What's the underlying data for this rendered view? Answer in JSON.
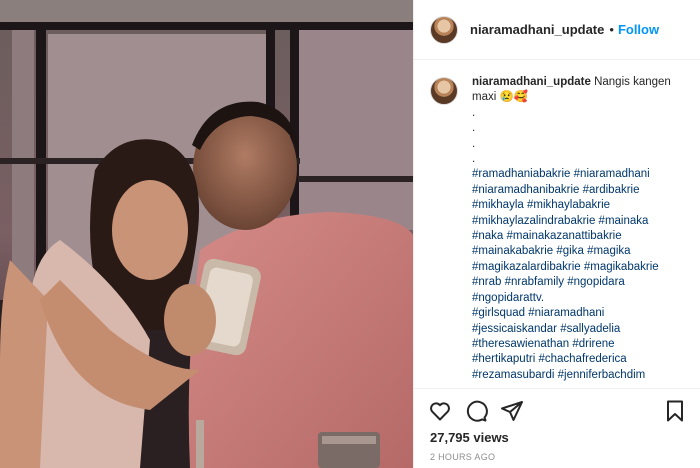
{
  "header": {
    "username": "niaramadhani_update",
    "separator": "•",
    "follow_label": "Follow"
  },
  "caption": {
    "username": "niaramadhani_update",
    "text": "Nangis kangen maxi",
    "emoji": "😢🥰",
    "dots": [
      ".",
      ".",
      ".",
      "."
    ],
    "hashtag_lines": [
      "#ramadhaniabakrie #niaramadhani",
      "#niaramadhanibakrie #ardibakrie",
      "#mikhayla #mikhaylabakrie",
      "#mikhaylazalindrabakrie #mainaka",
      "#naka #mainakazanattibakrie",
      "#mainakabakrie #gika #magika",
      "#magikazalardibakrie #magikabakrie",
      "#nrab #nrabfamily #ngopidara",
      "#ngopidarattv.",
      "#girlsquad #niaramadhani",
      "#jessicaiskandar #sallyadelia",
      "#theresawienathan #drirene",
      "#hertikaputri #chachafrederica",
      "#rezamasubardi #jenniferbachdim"
    ]
  },
  "actions": {
    "like_icon": "heart-icon",
    "comment_icon": "comment-icon",
    "share_icon": "paper-plane-icon",
    "save_icon": "bookmark-icon"
  },
  "stats": {
    "views": "27,795 views",
    "posted": "2 HOURS AGO"
  },
  "colors": {
    "follow_blue": "#0095f6",
    "hashtag_blue": "#00376b",
    "muted_gray": "#8e8e8e"
  }
}
